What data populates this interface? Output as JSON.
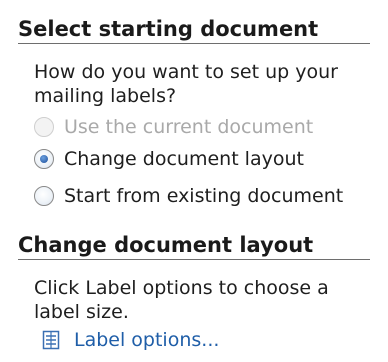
{
  "section1": {
    "title": "Select starting document",
    "prompt_line1": "How do you want to set up your",
    "prompt_line2": "mailing labels?",
    "options": [
      {
        "label": "Use the current document",
        "selected": false,
        "disabled": true
      },
      {
        "label": "Change document layout",
        "selected": true,
        "disabled": false
      },
      {
        "label": "Start from existing document",
        "selected": false,
        "disabled": false
      }
    ]
  },
  "section2": {
    "title": "Change document layout",
    "desc_line1": "Click Label options to choose a",
    "desc_line2": "label size.",
    "link": {
      "label": "Label options...",
      "icon": "label-options-icon"
    }
  },
  "colors": {
    "link": "#1f5ea8",
    "disabled_text": "#a9a9a9",
    "radio_selected": "#1f4f9a"
  }
}
